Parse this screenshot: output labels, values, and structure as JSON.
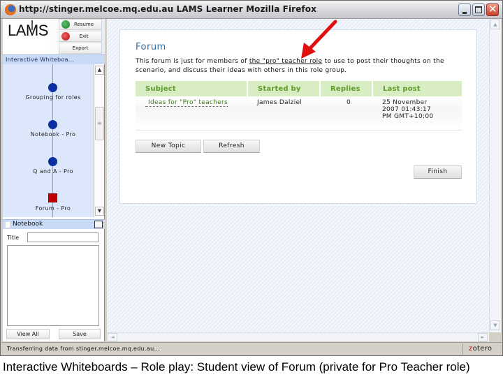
{
  "window": {
    "title": "http://stinger.melcoe.mq.edu.au  LAMS Learner  Mozilla Firefox",
    "controls": {
      "minimize": "_",
      "maximize": "□",
      "close": "✕"
    }
  },
  "lams": {
    "logo": {
      "part1": "LA",
      "part2": "M",
      "part3": "S"
    },
    "buttons": {
      "resume": "Resume",
      "exit": "Exit",
      "export": "Export"
    },
    "sequence": {
      "title": "Interactive Whiteboa...",
      "activities": [
        {
          "label": "Grouping for roles",
          "status": "completed"
        },
        {
          "label": "Notebook - Pro",
          "status": "completed"
        },
        {
          "label": "Q and A - Pro",
          "status": "completed"
        },
        {
          "label": "Forum - Pro",
          "status": "current"
        }
      ]
    },
    "notebook": {
      "header": "Notebook",
      "title_label": "Title",
      "title_value": "",
      "body_value": "",
      "view_all": "View All",
      "save": "Save"
    }
  },
  "forum": {
    "title": "Forum",
    "description_pre": "This forum is just for members of ",
    "description_link": "the \"pro\" teacher role",
    "description_post": " to use to post their thoughts on the scenario, and discuss their ideas with others in this role group.",
    "columns": [
      "Subject",
      "Started by",
      "Replies",
      "Last post"
    ],
    "topics": [
      {
        "subject": "Ideas for \"Pro\" teachers",
        "started_by": "James Dalziel",
        "replies": "0",
        "last_post": "25 November 2007 01:43:17 PM GMT+10:00"
      }
    ],
    "buttons": {
      "new_topic": "New Topic",
      "refresh": "Refresh",
      "finish": "Finish"
    }
  },
  "scrollbars": {
    "up": "▲",
    "down": "▼",
    "left": "◄",
    "right": "►"
  },
  "status": {
    "text": "Transferring data from stinger.melcoe.mq.edu.au...",
    "zotero_z": "z",
    "zotero_rest": "otero"
  },
  "annotation": {
    "arrow_color": "#e01010"
  },
  "caption": "Interactive Whiteboards – Role play: Student view of Forum (private for Pro Teacher role)"
}
